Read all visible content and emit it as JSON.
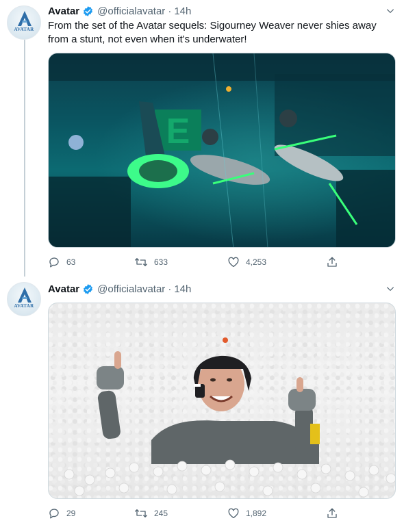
{
  "tweets": [
    {
      "author": {
        "name": "Avatar",
        "handle": "@officialavatar",
        "avatar_text": "AVATAR",
        "verified": true
      },
      "time": "14h",
      "separator": "·",
      "text": "From the set of the Avatar sequels: Sigourney Weaver never shies away from a stunt, not even when it's underwater!",
      "media": {
        "sign_letter": "E"
      },
      "actions": {
        "replies": "63",
        "retweets": "633",
        "likes": "4,253"
      }
    },
    {
      "author": {
        "name": "Avatar",
        "handle": "@officialavatar",
        "avatar_text": "AVATAR",
        "verified": true
      },
      "time": "14h",
      "separator": "·",
      "text": "",
      "actions": {
        "replies": "29",
        "retweets": "245",
        "likes": "1,892"
      }
    }
  ],
  "colors": {
    "verified": "#1d9bf0",
    "icon": "#536471",
    "mocap_green": "#39ff7a"
  },
  "icons": [
    "verified-badge-icon",
    "chevron-down-icon",
    "reply-icon",
    "retweet-icon",
    "like-icon",
    "share-icon"
  ]
}
